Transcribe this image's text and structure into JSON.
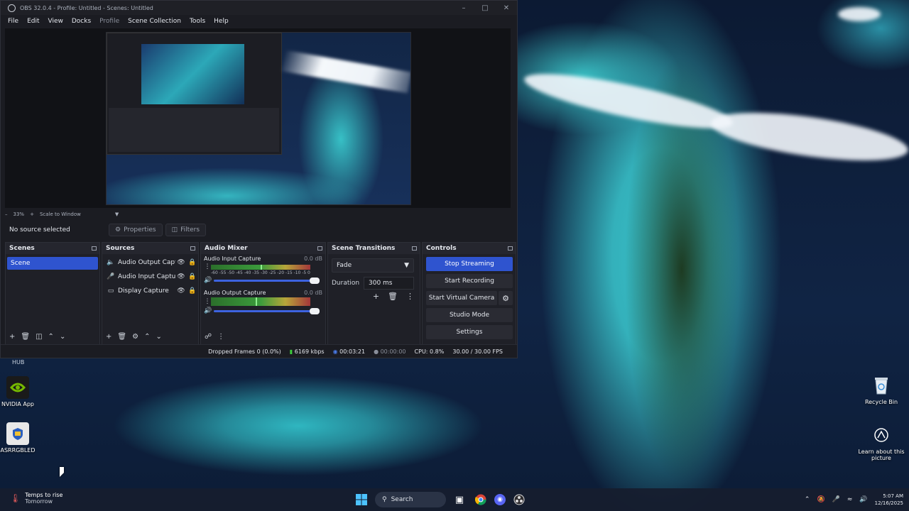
{
  "window": {
    "title": "OBS 32.0.4 - Profile: Untitled - Scenes: Untitled",
    "controls": [
      "minimize-icon",
      "maximize-icon",
      "close-icon"
    ]
  },
  "menu": [
    "File",
    "Edit",
    "View",
    "Docks",
    "Profile",
    "Scene Collection",
    "Tools",
    "Help"
  ],
  "zoom": {
    "percent": "33%",
    "mode": "Scale to Window"
  },
  "source_bar": {
    "no_source": "No source selected",
    "properties": "Properties",
    "filters": "Filters"
  },
  "scenes": {
    "title": "Scenes",
    "items": [
      "Scene"
    ]
  },
  "sources": {
    "title": "Sources",
    "items": [
      {
        "icon": "speaker-icon",
        "name": "Audio Output Capt"
      },
      {
        "icon": "microphone-icon",
        "name": "Audio Input Captu"
      },
      {
        "icon": "monitor-icon",
        "name": "Display Capture"
      }
    ]
  },
  "audio_mixer": {
    "title": "Audio Mixer",
    "scale": [
      "-60",
      "-55",
      "-50",
      "-45",
      "-40",
      "-35",
      "-30",
      "-25",
      "-20",
      "-15",
      "-10",
      "-5",
      "0"
    ],
    "channels": [
      {
        "name": "Audio Input Capture",
        "db": "0.0 dB",
        "level": 0.5,
        "volume": 1.0
      },
      {
        "name": "Audio Output Capture",
        "db": "0.0 dB",
        "level": 0.45,
        "volume": 1.0
      }
    ]
  },
  "transitions": {
    "title": "Scene Transitions",
    "selected": "Fade",
    "duration_label": "Duration",
    "duration": "300 ms"
  },
  "controls": {
    "title": "Controls",
    "stop_streaming": "Stop Streaming",
    "start_recording": "Start Recording",
    "start_virtual_camera": "Start Virtual Camera",
    "studio_mode": "Studio Mode",
    "settings": "Settings"
  },
  "status": {
    "dropped": "Dropped Frames 0 (0.0%)",
    "bitrate": "6169 kbps",
    "stream_time": "00:03:21",
    "rec_time": "00:00:00",
    "cpu": "CPU: 0.8%",
    "fps": "30.00 / 30.00 FPS"
  },
  "desktop": {
    "hub_label": "HUB",
    "icons": [
      {
        "label": "NVIDIA App",
        "icon": "nvidia-icon"
      },
      {
        "label": "ASRRGBLED",
        "icon": "asrock-icon"
      },
      {
        "label": "Recycle Bin",
        "icon": "recycle-bin-icon"
      },
      {
        "label": "Learn about this picture",
        "icon": "camera-icon"
      }
    ]
  },
  "taskbar": {
    "weather_title": "Temps to rise",
    "weather_sub": "Tomorrow",
    "search": "Search",
    "time": "5:07 AM",
    "date": "12/16/2025"
  }
}
